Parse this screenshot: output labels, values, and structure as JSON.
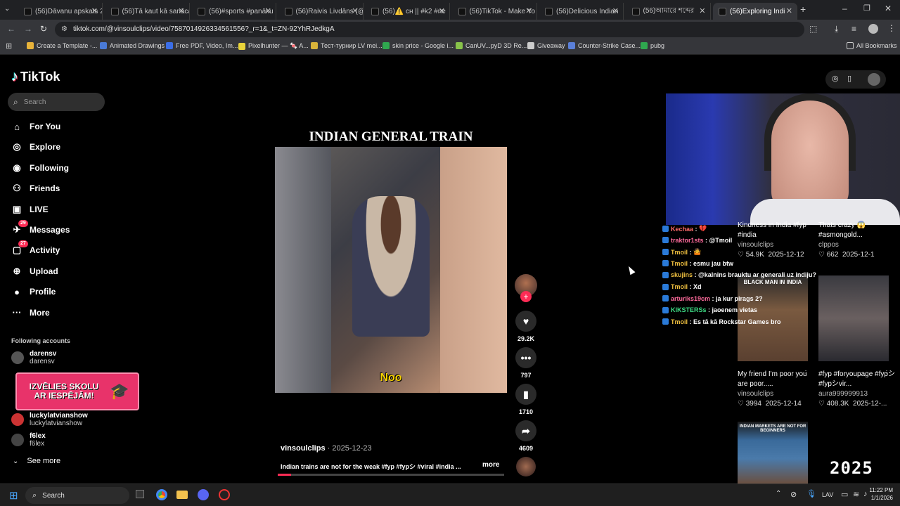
{
  "browser": {
    "tabs": [
      {
        "title": "(56)Dāvanu apskats 2"
      },
      {
        "title": "(56)Tā kaut kā sanāca"
      },
      {
        "title": "(56)#sports #panāku"
      },
      {
        "title": "(56)Raivis Livdāns (@"
      },
      {
        "title": "(56)⚠️ cн || #k2 #ne"
      },
      {
        "title": "(56)TikTok - Make Yo"
      },
      {
        "title": "(56)Delicious Indian"
      },
      {
        "title": "(56)আমারে শব্দের"
      },
      {
        "title": "(56)Exploring Indi"
      }
    ],
    "url": "tiktok.com/@vinsoulclips/video/7587014926334561556?_r=1&_t=ZN-92YhRJedkgA",
    "bookmarks": [
      {
        "label": "Create a Template -...",
        "color": "#e8b33a"
      },
      {
        "label": "Animated Drawings",
        "color": "#4a7bd8"
      },
      {
        "label": "Free PDF, Video, Im...",
        "color": "#3b6ee8"
      },
      {
        "label": "Pixelhunter — 🍬 A...",
        "color": "#e8d33a"
      },
      {
        "label": "Тест-турнир LV mei...",
        "color": "#d9b43a"
      },
      {
        "label": "skin price - Google i...",
        "color": "#2fa84f"
      },
      {
        "label": "CanUV...pyD 3D Re...",
        "color": "#88c34a"
      },
      {
        "label": "Giveaway",
        "color": "#cccccc"
      },
      {
        "label": "Counter-Strike Case...",
        "color": "#5a7fd8"
      },
      {
        "label": "pubg",
        "color": "#2fa84f"
      }
    ],
    "all_bookmarks": "All Bookmarks"
  },
  "sidebar": {
    "logo": "TikTok",
    "search_placeholder": "Search",
    "items": [
      {
        "label": "For You",
        "icon": "home-icon"
      },
      {
        "label": "Explore",
        "icon": "compass-icon"
      },
      {
        "label": "Following",
        "icon": "following-icon"
      },
      {
        "label": "Friends",
        "icon": "friends-icon"
      },
      {
        "label": "LIVE",
        "icon": "live-icon"
      },
      {
        "label": "Messages",
        "icon": "messages-icon",
        "badge": "29"
      },
      {
        "label": "Activity",
        "icon": "activity-icon",
        "badge": "27"
      },
      {
        "label": "Upload",
        "icon": "upload-icon"
      },
      {
        "label": "Profile",
        "icon": "profile-icon"
      },
      {
        "label": "More",
        "icon": "more-icon"
      }
    ],
    "following_header": "Following accounts",
    "accounts": [
      {
        "name": "darensv",
        "handle": "darensv"
      },
      {
        "name": "luckylatvianshow",
        "handle": "luckylatvianshow"
      },
      {
        "name": "f6lex",
        "handle": "f6lex"
      }
    ],
    "see_more": "See more",
    "ad_text": "IZVĒLIES SKOLU AR IESPĒJĀM!"
  },
  "video": {
    "overlay_title": "INDIAN GENERAL TRAIN",
    "caption_sub": "Noo",
    "author": "vinsoulclips",
    "date": "2025-12-23",
    "description": "Indian trains are not for the weak #fyp #fypシ #viral #india ...",
    "more": "more",
    "progress": 0.06,
    "likes": "29.2K",
    "comments": "797",
    "saves": "1710",
    "shares": "4609"
  },
  "chat": [
    {
      "user": "Kechaa",
      "msg": "💔",
      "color": "#ff6b6b"
    },
    {
      "user": "traktor1sts",
      "msg": "@Tmoil",
      "color": "#ff6b9c"
    },
    {
      "user": "Tmoil",
      "msg": "🤷",
      "color": "#f0c040"
    },
    {
      "user": "Tmoil",
      "msg": "esmu jau btw",
      "color": "#f0c040"
    },
    {
      "user": "skujins",
      "msg": "@kalnins brauktu ar generali uz indiju?",
      "color": "#f0c040"
    },
    {
      "user": "Tmoil",
      "msg": "Xd",
      "color": "#f0c040"
    },
    {
      "user": "arturiks19cm",
      "msg": "ja kur pirags 2?",
      "color": "#ff6b9c"
    },
    {
      "user": "KIKSTERSs",
      "msg": "jaoenem vietas",
      "color": "#3ddc84"
    },
    {
      "user": "Tmoil",
      "msg": "Es tā kā Rockstar Games bro",
      "color": "#f0c040"
    }
  ],
  "related": [
    {
      "title": "Kindness in India #fyp #india",
      "author": "vinsoulclips",
      "likes": "54.9K",
      "date": "2025-12-12"
    },
    {
      "title": "Thats crazy 😱 #asmongold...",
      "author": "clppos",
      "likes": "662",
      "date": "2025-12-1"
    },
    {
      "title": "My friend I'm poor you are poor.....",
      "author": "vinsoulclips",
      "likes": "3994",
      "date": "2025-12-14",
      "thumb_text": "BLACK MAN IN INDIA"
    },
    {
      "title": "#fyp #foryoupage #fypシ #fypシvir...",
      "author": "aura999999913",
      "likes": "408.3K",
      "date": "2025-12-..."
    },
    {
      "thumb_text": "INDIAN MARKETS ARE NOT FOR BEGINNERS"
    }
  ],
  "overlay_year": "2025",
  "taskbar": {
    "search": "Search",
    "lang": "LAV",
    "time": "11:22 PM",
    "date": "1/1/2026"
  }
}
